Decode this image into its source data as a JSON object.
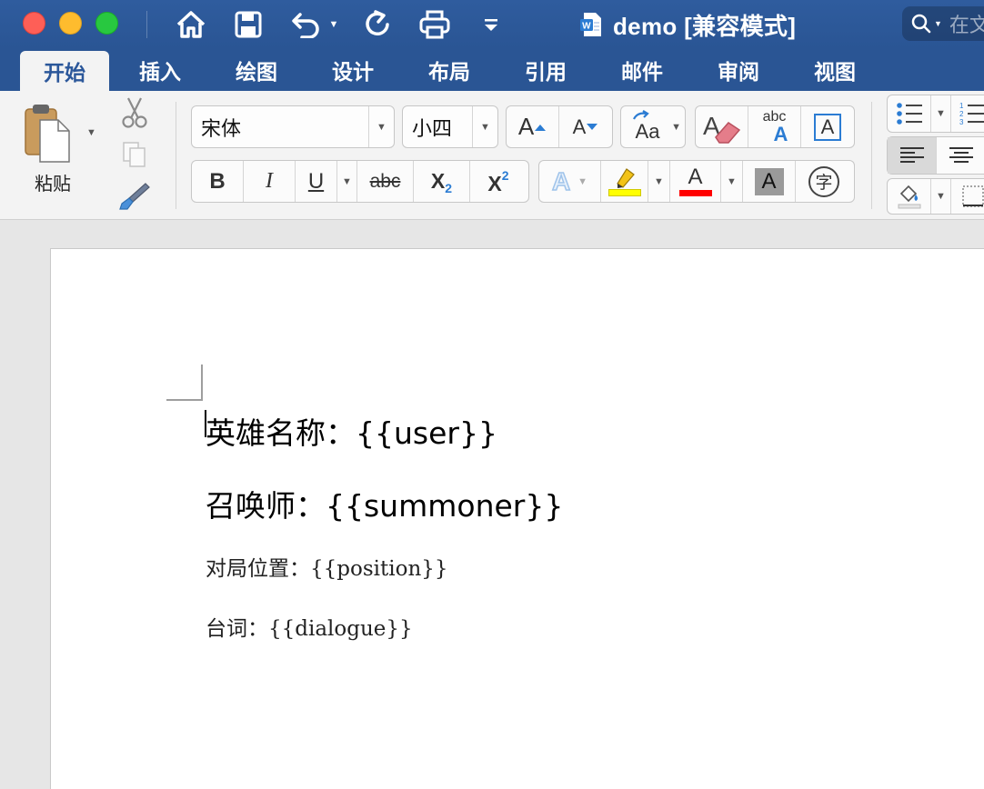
{
  "window": {
    "title": "demo [兼容模式]",
    "search_placeholder": "在文"
  },
  "toolbar_icons": [
    "home-icon",
    "save-icon",
    "undo-icon",
    "redo-icon",
    "print-icon",
    "customize-toolbar-icon"
  ],
  "tabs": [
    {
      "label": "开始",
      "active": true
    },
    {
      "label": "插入"
    },
    {
      "label": "绘图"
    },
    {
      "label": "设计"
    },
    {
      "label": "布局"
    },
    {
      "label": "引用"
    },
    {
      "label": "邮件"
    },
    {
      "label": "审阅"
    },
    {
      "label": "视图"
    }
  ],
  "ribbon": {
    "paste_label": "粘贴",
    "font_name": "宋体",
    "font_size": "小四",
    "grow_font_glyph": "A",
    "shrink_font_glyph": "A",
    "change_case_glyph": "Aa",
    "bold": "B",
    "italic": "I",
    "underline": "U",
    "strikethrough": "abc",
    "subscript": "X",
    "subscript_mark": "2",
    "superscript": "X",
    "superscript_mark": "2",
    "text_effects_glyph": "A",
    "font_color_glyph": "A",
    "char_shading_glyph": "A",
    "enclose_char_glyph": "字",
    "phonetic_glyph_top": "abc",
    "phonetic_glyph_bottom": "A",
    "char_border_glyph": "A",
    "highlight_color": "#ffff00",
    "font_color": "#ff0000"
  },
  "document": {
    "lines": [
      {
        "text": "英雄名称：{{user}}",
        "style": "heading"
      },
      {
        "text": "召唤师：{{summoner}}",
        "style": "heading"
      },
      {
        "text": "对局位置：{{position}}",
        "style": "body"
      },
      {
        "text": "台词：{{dialogue}}",
        "style": "body"
      }
    ]
  },
  "colors": {
    "title_bar": "#2a5594",
    "ribbon_bg": "#f3f3f3",
    "active_tab_text": "#2b579a"
  }
}
